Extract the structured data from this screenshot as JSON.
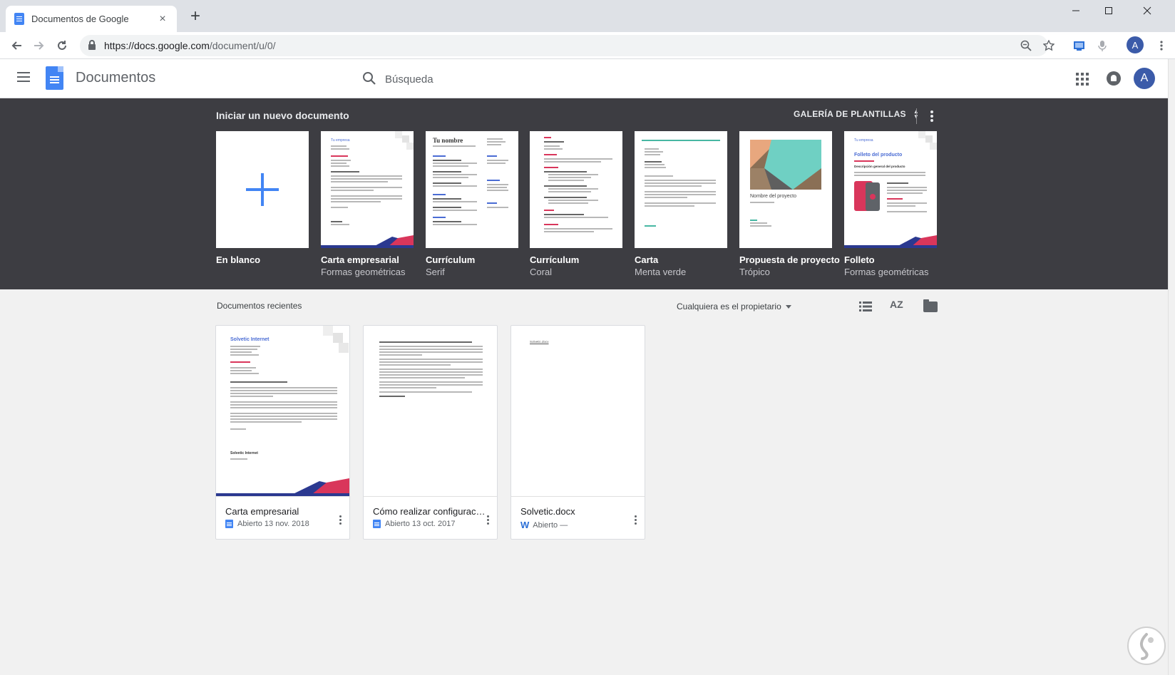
{
  "browser": {
    "tab_title": "Documentos de Google",
    "tab_close": "×",
    "new_tab": "+",
    "url_host": "https://docs.google.com",
    "url_path": "/document/u/0/",
    "profile_initial": "A"
  },
  "app": {
    "title": "Documentos",
    "search_placeholder": "Búsqueda",
    "avatar_initial": "A"
  },
  "templates": {
    "heading": "Iniciar un nuevo documento",
    "gallery_label": "GALERÍA DE PLANTILLAS",
    "items": [
      {
        "name": "En blanco",
        "sub": ""
      },
      {
        "name": "Carta empresarial",
        "sub": "Formas geométricas"
      },
      {
        "name": "Currículum",
        "sub": "Serif"
      },
      {
        "name": "Currículum",
        "sub": "Coral"
      },
      {
        "name": "Carta",
        "sub": "Menta verde"
      },
      {
        "name": "Propuesta de proyecto",
        "sub": "Trópico"
      },
      {
        "name": "Folleto",
        "sub": "Formas geométricas"
      }
    ],
    "thumb_text": {
      "resume_name": "Tu nombre",
      "company": "Tu empresa",
      "project_name": "Nombre del proyecto",
      "brochure_title": "Folleto del producto",
      "brochure_sub": "Descripción general del producto"
    },
    "colors": {
      "accent_blue": "#4285f4",
      "geo_pink": "#d9365b",
      "geo_navy": "#2b3990",
      "mint": "#47b7a3"
    }
  },
  "recent": {
    "heading": "Documentos recientes",
    "owner_filter": "Cualquiera es el propietario",
    "sort_label": "AZ",
    "docs": [
      {
        "title": "Carta empresarial",
        "status": "Abierto",
        "date": "13 nov. 2018",
        "type": "docs-icon",
        "thumb_company": "Solvetic Internet",
        "thumb_sign": "Solvetic Internet"
      },
      {
        "title": "Cómo realizar configuraci...",
        "status": "Abierto",
        "date": "13 oct. 2017",
        "type": "docs-icon"
      },
      {
        "title": "Solvetic.docx",
        "status": "Abierto",
        "date": "—",
        "type": "word-icon",
        "thumb_text": "Solvetic.docx"
      }
    ]
  }
}
